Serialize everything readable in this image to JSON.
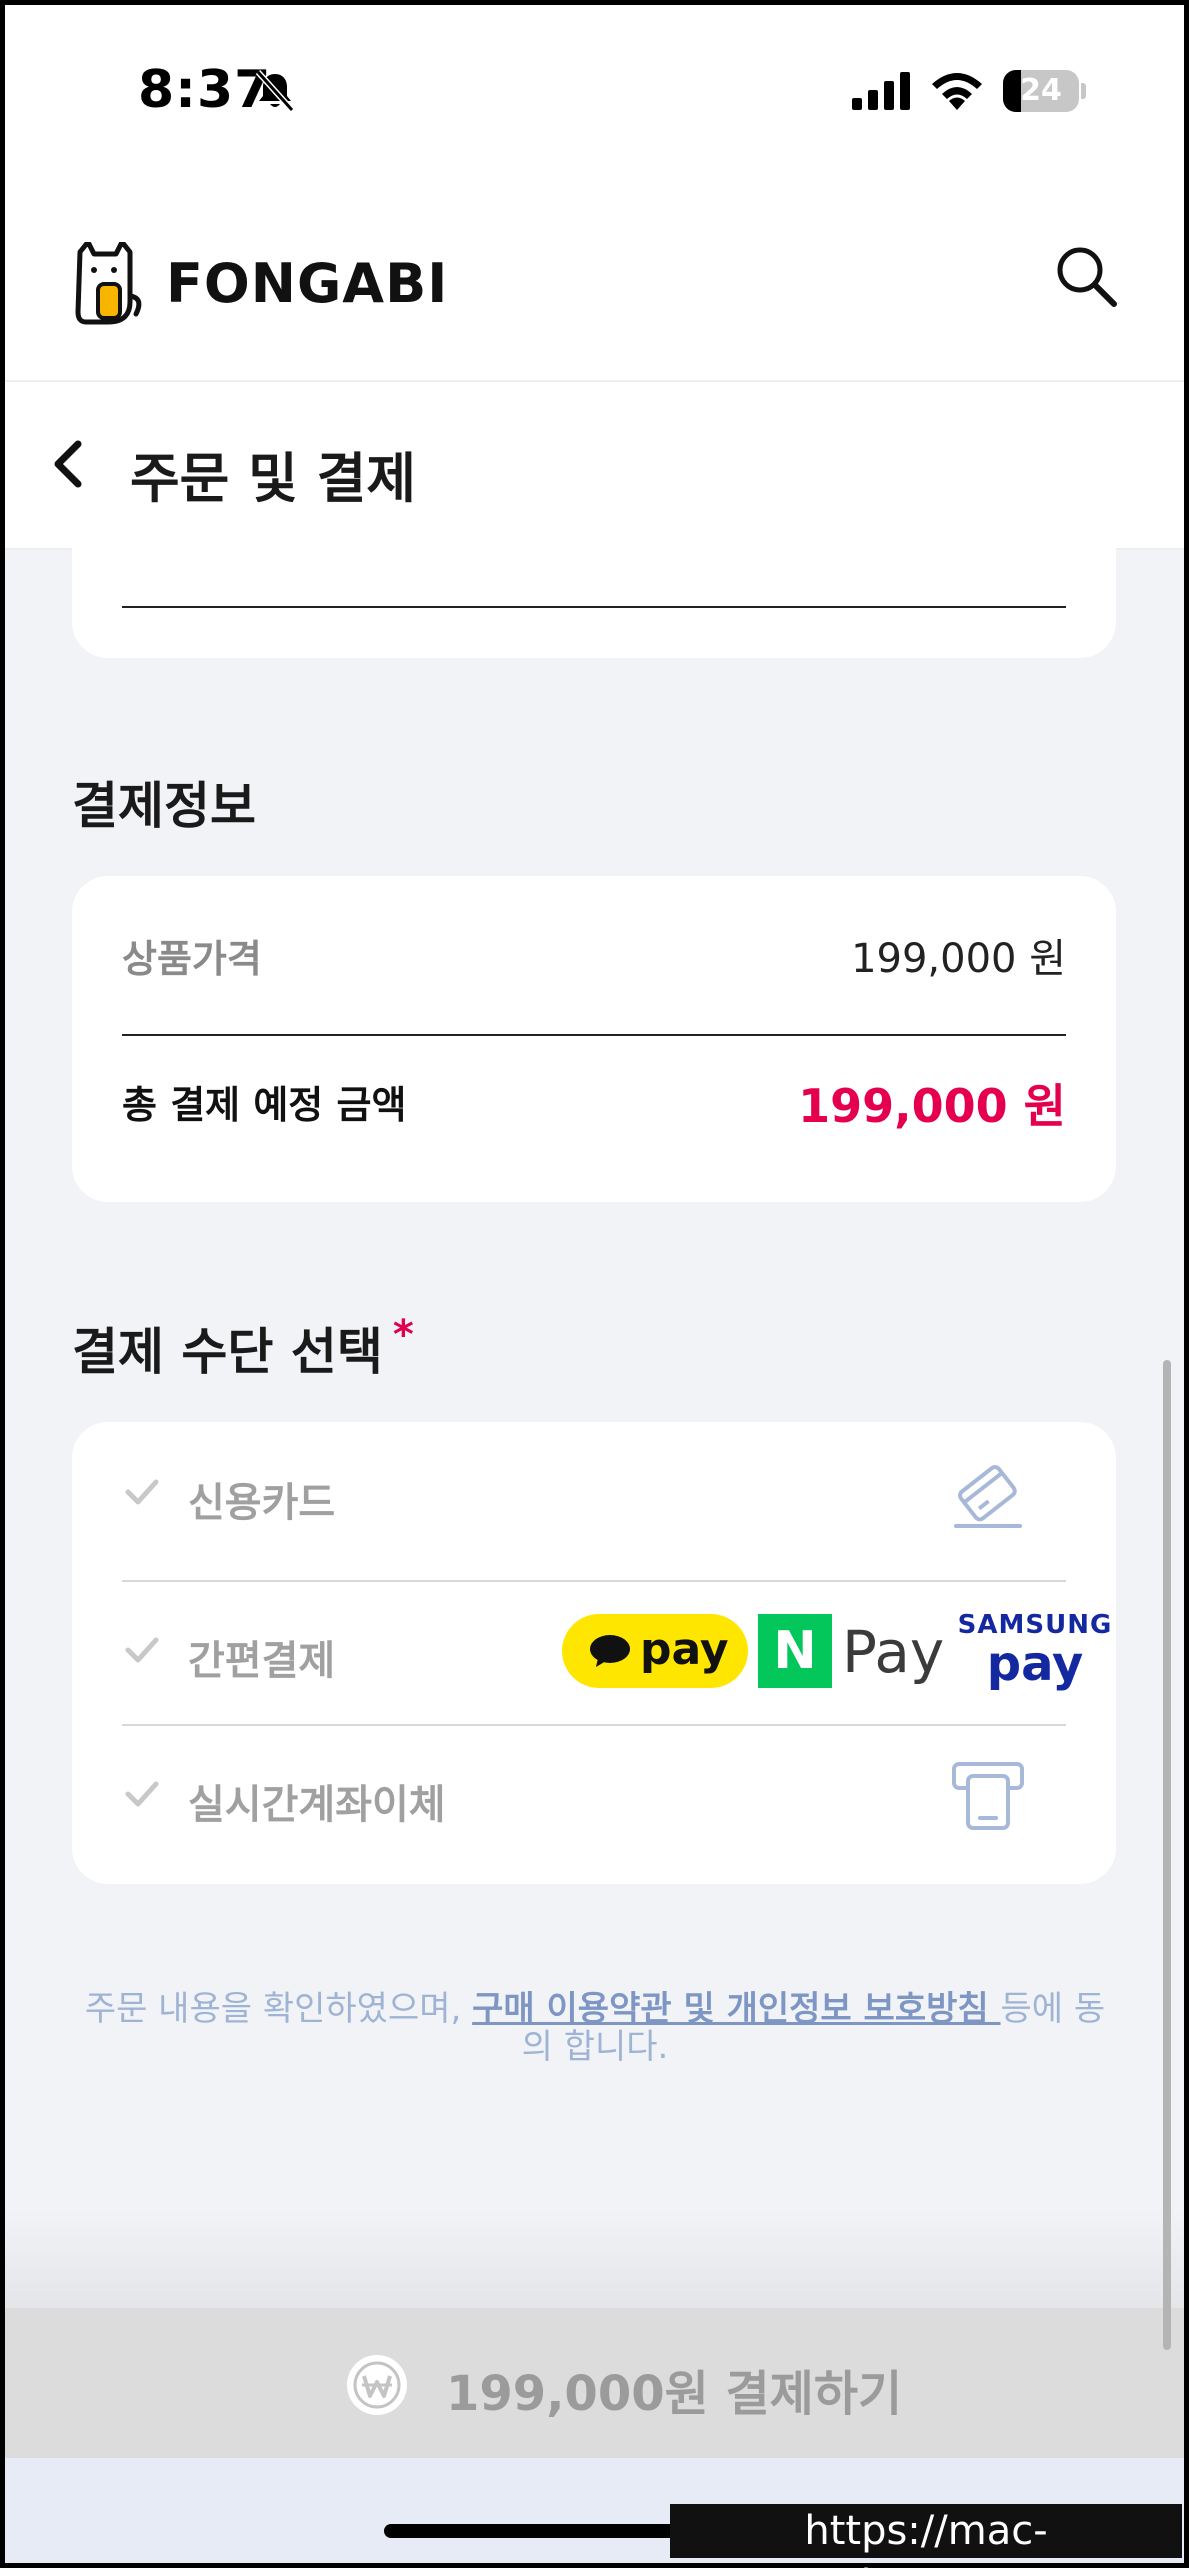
{
  "status_bar": {
    "time": "8:37",
    "battery": "24",
    "battery_level": 0.24
  },
  "header": {
    "brand": "FONGABI",
    "logo_icon": "cat-logo-icon",
    "search_icon": "search-icon"
  },
  "title_bar": {
    "back_icon": "chevron-left-icon",
    "title": "주문 및 결제"
  },
  "payment_info": {
    "section_title": "결제정보",
    "product_price_label": "상품가격",
    "product_price_value": "199,000 원",
    "total_label": "총 결제 예정 금액",
    "total_value": "199,000 원"
  },
  "payment_method": {
    "section_title": "결제 수단 선택",
    "required_mark": "*",
    "options": [
      {
        "label": "신용카드",
        "icon": "credit-card-icon"
      },
      {
        "label": "간편결제",
        "icon": "easy-pay-logos"
      },
      {
        "label": "실시간계좌이체",
        "icon": "atm-icon"
      }
    ],
    "easy_pay": {
      "kakao": "pay",
      "naver": "Pay",
      "naver_letter": "N",
      "samsung_top": "SAMSUNG",
      "samsung_bottom": "pay"
    }
  },
  "agreement": {
    "prefix": "주문 내용을 확인하였으며, ",
    "link": "구매 이용약관 및 개인정보 보호방침 ",
    "suffix": "등에 동의 합니다."
  },
  "pay_button": {
    "label": "199,000원 결제하기",
    "icon": "won-icon"
  },
  "watermark": "https://mac-os.tistory.com",
  "colors": {
    "accent_red": "#e4004e",
    "kakao_yellow": "#ffe600",
    "naver_green": "#03c75a",
    "samsung_blue": "#1428a0"
  }
}
